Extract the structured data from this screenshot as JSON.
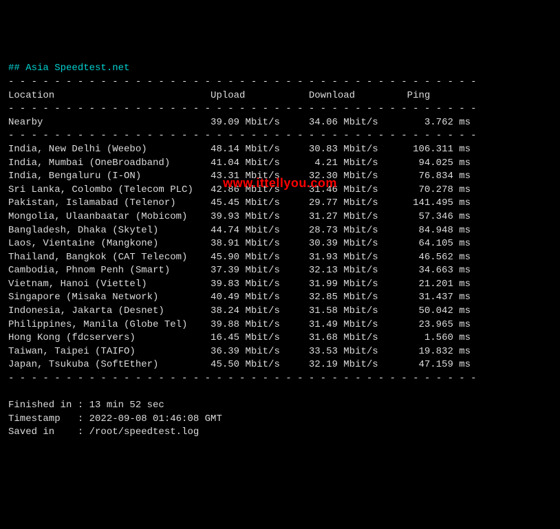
{
  "title": "## Asia Speedtest.net",
  "divider": "- - - - - - - - - - - - - - - - - - - - - - - - - - - - - - - - - - - - - - - - -",
  "headers": {
    "location": "Location",
    "upload": "Upload",
    "download": "Download",
    "ping": "Ping"
  },
  "unit_speed": "Mbit/s",
  "unit_ping": "ms",
  "nearby": {
    "label": "Nearby",
    "upload": "39.09",
    "download": "34.06",
    "ping": "3.762"
  },
  "rows": [
    {
      "location": "India, New Delhi (Weebo)",
      "upload": "48.14",
      "download": "30.83",
      "ping": "106.311"
    },
    {
      "location": "India, Mumbai (OneBroadband)",
      "upload": "41.04",
      "download": "4.21",
      "ping": "94.025"
    },
    {
      "location": "India, Bengaluru (I-ON)",
      "upload": "43.31",
      "download": "32.30",
      "ping": "76.834"
    },
    {
      "location": "Sri Lanka, Colombo (Telecom PLC)",
      "upload": "42.86",
      "download": "31.46",
      "ping": "70.278"
    },
    {
      "location": "Pakistan, Islamabad (Telenor)",
      "upload": "45.45",
      "download": "29.77",
      "ping": "141.495"
    },
    {
      "location": "Mongolia, Ulaanbaatar (Mobicom)",
      "upload": "39.93",
      "download": "31.27",
      "ping": "57.346"
    },
    {
      "location": "Bangladesh, Dhaka (Skytel)",
      "upload": "44.74",
      "download": "28.73",
      "ping": "84.948"
    },
    {
      "location": "Laos, Vientaine (Mangkone)",
      "upload": "38.91",
      "download": "30.39",
      "ping": "64.105"
    },
    {
      "location": "Thailand, Bangkok (CAT Telecom)",
      "upload": "45.90",
      "download": "31.93",
      "ping": "46.562"
    },
    {
      "location": "Cambodia, Phnom Penh (Smart)",
      "upload": "37.39",
      "download": "32.13",
      "ping": "34.663"
    },
    {
      "location": "Vietnam, Hanoi (Viettel)",
      "upload": "39.83",
      "download": "31.99",
      "ping": "21.201"
    },
    {
      "location": "Singapore (Misaka Network)",
      "upload": "40.49",
      "download": "32.85",
      "ping": "31.437"
    },
    {
      "location": "Indonesia, Jakarta (Desnet)",
      "upload": "38.24",
      "download": "31.58",
      "ping": "50.042"
    },
    {
      "location": "Philippines, Manila (Globe Tel)",
      "upload": "39.88",
      "download": "31.49",
      "ping": "23.965"
    },
    {
      "location": "Hong Kong (fdcservers)",
      "upload": "16.45",
      "download": "31.68",
      "ping": "1.560"
    },
    {
      "location": "Taiwan, Taipei (TAIFO)",
      "upload": "36.39",
      "download": "33.53",
      "ping": "19.832"
    },
    {
      "location": "Japan, Tsukuba (SoftEther)",
      "upload": "45.50",
      "download": "32.19",
      "ping": "47.159"
    }
  ],
  "footer": {
    "finished_label": "Finished in : ",
    "finished_value": "13 min 52 sec",
    "timestamp_label": "Timestamp   : ",
    "timestamp_value": "2022-09-08 01:46:08 GMT",
    "saved_label": "Saved in    : ",
    "saved_value": "/root/speedtest.log"
  },
  "watermark": "www.ittellyou.com"
}
